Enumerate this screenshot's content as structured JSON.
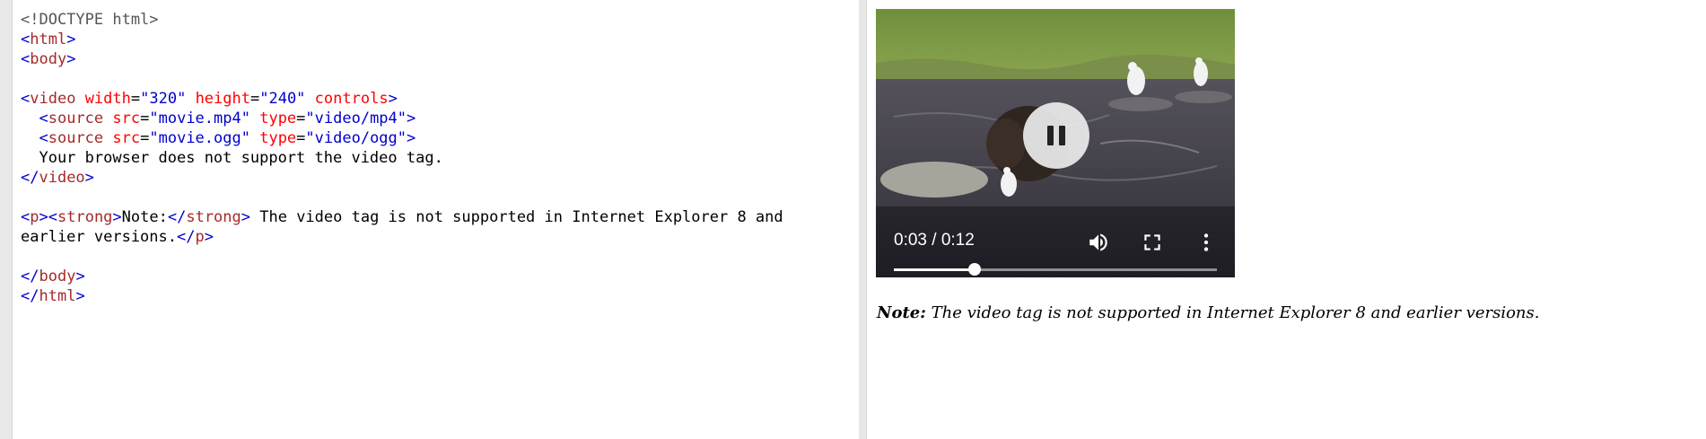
{
  "editor": {
    "lines": [
      "<!DOCTYPE html>",
      "<html>",
      "<body>",
      "",
      "<video width=\"320\" height=\"240\" controls>",
      "  <source src=\"movie.mp4\" type=\"video/mp4\">",
      "  <source src=\"movie.ogg\" type=\"video/ogg\">",
      "  Your browser does not support the video tag.",
      "</video>",
      "",
      "<p><strong>Note:</strong> The video tag is not supported in Internet Explorer 8 and",
      "earlier versions.</p>",
      "",
      "</body>",
      "</html>"
    ]
  },
  "result": {
    "video": {
      "time_display": "0:03 / 0:12",
      "progress": 0.25,
      "state": "playing",
      "controls": {
        "pause_icon": "pause-icon",
        "volume_icon": "volume-icon",
        "fullscreen_icon": "fullscreen-icon",
        "more_icon": "more-vertical-icon"
      }
    },
    "note": {
      "strong": "Note:",
      "text": " The video tag is not supported in Internet Explorer 8 and earlier versions."
    }
  },
  "colors": {
    "tag": "#a52a2a",
    "bracket": "#0000cd",
    "attribute": "#ff0000",
    "value": "#0000cd"
  }
}
